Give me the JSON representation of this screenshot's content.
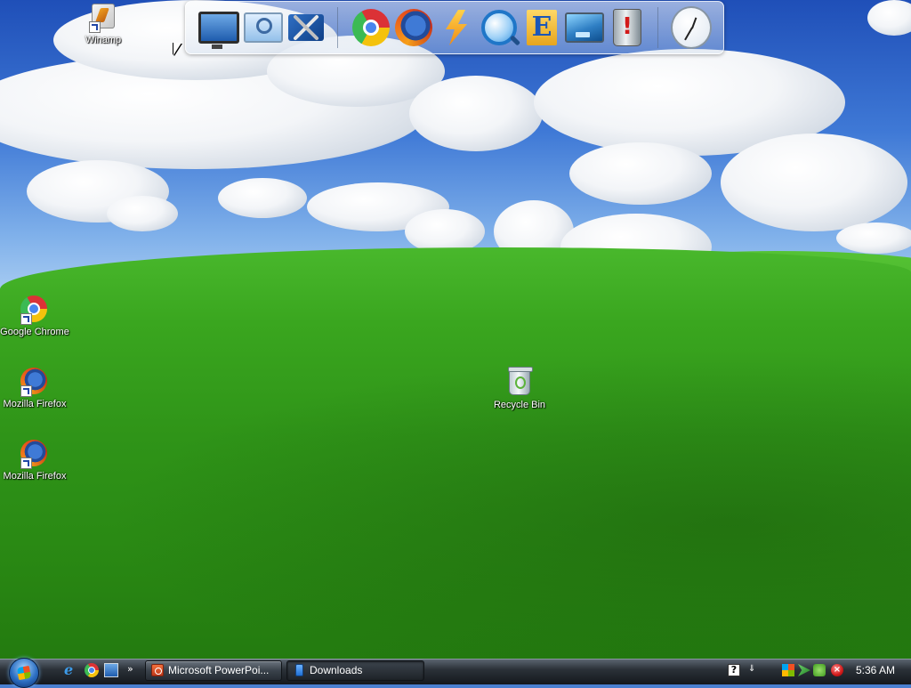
{
  "desktop": {
    "icons": [
      {
        "label": "Winamp",
        "icon": "winamp-icon"
      },
      {
        "label": "Google Chrome",
        "icon": "chrome-icon"
      },
      {
        "label": "Mozilla Firefox",
        "icon": "firefox-icon"
      },
      {
        "label": "Mozilla Firefox",
        "icon": "firefox-icon"
      },
      {
        "label": "Recycle Bin",
        "icon": "recycle-bin-icon"
      }
    ]
  },
  "dock": {
    "items": [
      {
        "icon": "computer-icon"
      },
      {
        "icon": "search-computer-icon"
      },
      {
        "icon": "tools-icon"
      },
      {
        "icon": "chrome-icon"
      },
      {
        "icon": "firefox-icon"
      },
      {
        "icon": "lightning-icon"
      },
      {
        "icon": "magnifier-icon"
      },
      {
        "icon": "folder-e-icon"
      },
      {
        "icon": "screen-icon"
      },
      {
        "icon": "trash-icon"
      },
      {
        "icon": "clock-icon"
      }
    ]
  },
  "taskbar": {
    "quick_launch": [
      {
        "icon": "internet-explorer-icon",
        "glyph": "e"
      },
      {
        "icon": "chrome-icon"
      },
      {
        "icon": "show-desktop-icon"
      },
      {
        "icon": "chevron-more-icon",
        "glyph": "»"
      }
    ],
    "tasks": [
      {
        "label": "Microsoft PowerPoi...",
        "icon": "powerpoint-icon",
        "active": false
      },
      {
        "label": "Downloads",
        "icon": "folder-icon",
        "active": true
      }
    ],
    "tray": {
      "help_glyph": "?",
      "sep_glyph": "⇓",
      "stop_glyph": "×",
      "clock": "5:36 AM"
    }
  },
  "colors": {
    "sky_top": "#1f4fb8",
    "grass": "#2f9418",
    "taskbar": "#2b3138"
  }
}
